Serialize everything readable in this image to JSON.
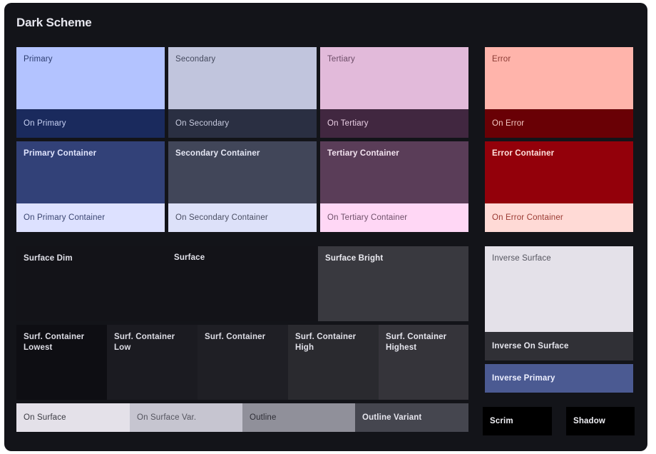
{
  "title": "Dark Scheme",
  "colors": {
    "primary": "#b3c3ff",
    "on_primary": "#1a2a5d",
    "primary_container": "#324178",
    "on_primary_container": "#dde1ff",
    "secondary": "#c1c5dd",
    "on_secondary": "#2a2f42",
    "secondary_container": "#414659",
    "on_secondary_container": "#dde1f9",
    "tertiary": "#e2bada",
    "on_tertiary": "#412740",
    "tertiary_container": "#5a3d58",
    "on_tertiary_container": "#ffd7f5",
    "error": "#ffb4ab",
    "on_error": "#690005",
    "error_container": "#93000a",
    "on_error_container": "#ffdad6",
    "surface_dim": "#131318",
    "surface": "#131318",
    "surface_bright": "#39393f",
    "surf_container_lowest": "#0e0e13",
    "surf_container_low": "#1b1b21",
    "surf_container": "#1f1f25",
    "surf_container_high": "#2a2a2f",
    "surf_container_highest": "#35343a",
    "inverse_surface": "#e4e1e9",
    "inverse_on_surface": "#303036",
    "inverse_primary": "#4b5a92",
    "on_surface": "#e4e1e9",
    "on_surface_var": "#c6c5d0",
    "outline": "#90909a",
    "outline_variant": "#45464f",
    "scrim": "#000000",
    "shadow": "#000000"
  },
  "labels": {
    "primary": "Primary",
    "on_primary": "On Primary",
    "primary_container": "Primary Container",
    "on_primary_container": "On Primary Container",
    "secondary": "Secondary",
    "on_secondary": "On Secondary",
    "secondary_container": "Secondary Container",
    "on_secondary_container": "On Secondary Container",
    "tertiary": "Tertiary",
    "on_tertiary": "On Tertiary",
    "tertiary_container": "Tertiary Container",
    "on_tertiary_container": "On Tertiary Container",
    "error": "Error",
    "on_error": "On Error",
    "error_container": "Error Container",
    "on_error_container": "On Error Container",
    "surface_dim": "Surface Dim",
    "surface": "Surface",
    "surface_bright": "Surface Bright",
    "surf_container_lowest_1": "Surf. Container",
    "surf_container_lowest_2": "Lowest",
    "surf_container_low_1": "Surf. Container",
    "surf_container_low_2": "Low",
    "surf_container": "Surf. Container",
    "surf_container_high_1": "Surf. Container",
    "surf_container_high_2": "High",
    "surf_container_highest_1": "Surf. Container",
    "surf_container_highest_2": "Highest",
    "inverse_surface": "Inverse Surface",
    "inverse_on_surface": "Inverse On Surface",
    "inverse_primary": "Inverse Primary",
    "on_surface": "On Surface",
    "on_surface_var": "On Surface Var.",
    "outline": "Outline",
    "outline_variant": "Outline Variant",
    "scrim": "Scrim",
    "shadow": "Shadow"
  }
}
